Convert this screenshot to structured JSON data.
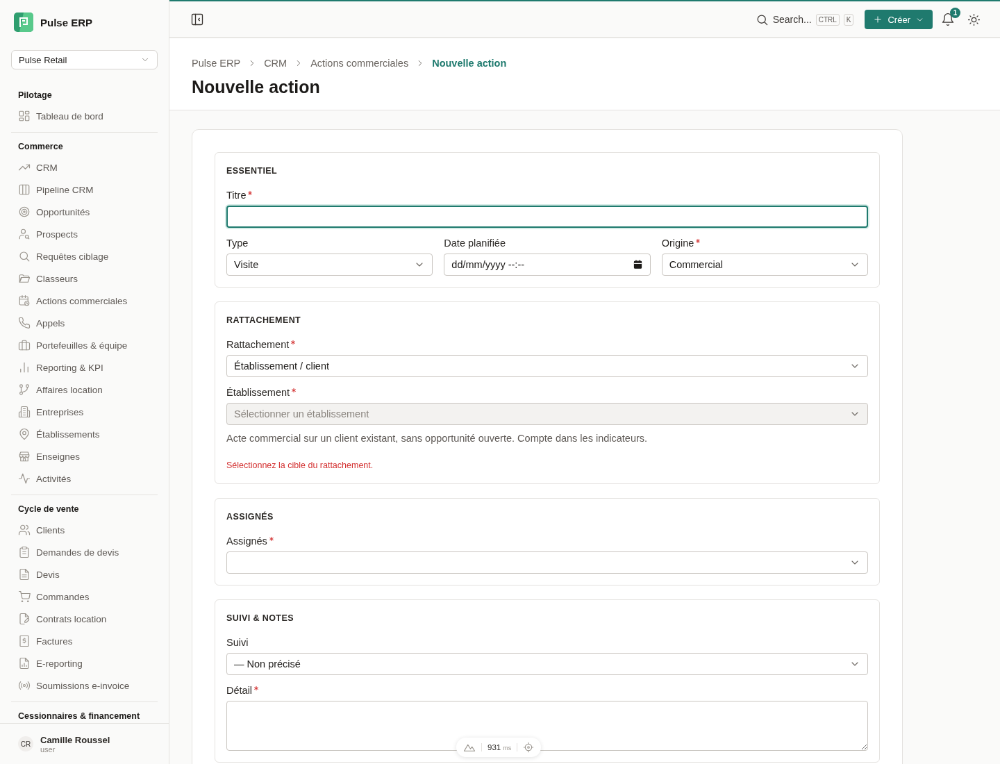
{
  "app": {
    "name": "Pulse ERP"
  },
  "workspace": {
    "value": "Pulse Retail"
  },
  "sidebar": {
    "groups": [
      {
        "title": "Pilotage",
        "items": [
          {
            "label": "Tableau de bord"
          }
        ]
      },
      {
        "title": "Commerce",
        "items": [
          {
            "label": "CRM"
          },
          {
            "label": "Pipeline CRM"
          },
          {
            "label": "Opportunités"
          },
          {
            "label": "Prospects"
          },
          {
            "label": "Requêtes ciblage"
          },
          {
            "label": "Classeurs"
          },
          {
            "label": "Actions commerciales"
          },
          {
            "label": "Appels"
          },
          {
            "label": "Portefeuilles & équipe"
          },
          {
            "label": "Reporting & KPI"
          },
          {
            "label": "Affaires location"
          },
          {
            "label": "Entreprises"
          },
          {
            "label": "Établissements"
          },
          {
            "label": "Enseignes"
          },
          {
            "label": "Activités"
          }
        ]
      },
      {
        "title": "Cycle de vente",
        "items": [
          {
            "label": "Clients"
          },
          {
            "label": "Demandes de devis"
          },
          {
            "label": "Devis"
          },
          {
            "label": "Commandes"
          },
          {
            "label": "Contrats location"
          },
          {
            "label": "Factures"
          },
          {
            "label": "E-reporting"
          },
          {
            "label": "Soumissions e-invoice"
          }
        ]
      },
      {
        "title": "Cessionnaires & financement"
      }
    ]
  },
  "user": {
    "initials": "CR",
    "name": "Camille Roussel",
    "role": "user"
  },
  "topbar": {
    "search": "Search...",
    "shortcut": [
      "CTRL",
      "K"
    ],
    "create_button": "Créer",
    "notifications": "1"
  },
  "breadcrumb": [
    {
      "label": "Pulse ERP",
      "selected": false
    },
    {
      "label": "CRM",
      "selected": false
    },
    {
      "label": "Actions commerciales",
      "selected": false
    },
    {
      "label": "Nouvelle action",
      "selected": true
    }
  ],
  "page_title": "Nouvelle action",
  "sections": [
    {
      "title": "ESSENTIEL",
      "rows": [
        [
          {
            "kind": "text",
            "label": "Titre",
            "required": true,
            "focused": true
          }
        ],
        [
          {
            "kind": "select",
            "label": "Type",
            "required": false,
            "value": "Visite"
          },
          {
            "kind": "datetime",
            "label": "Date planifiée",
            "required": false,
            "placeholder": "dd/mm/yyyy --:--"
          },
          {
            "kind": "select",
            "label": "Origine",
            "required": true,
            "value": "Commercial"
          }
        ]
      ]
    },
    {
      "title": "RATTACHEMENT",
      "rows": [
        [
          {
            "kind": "select",
            "label": "Rattachement",
            "required": true,
            "value": "Établissement / client"
          }
        ],
        [
          {
            "kind": "select",
            "label": "Établissement",
            "required": true,
            "placeholder": "Sélectionner un établissement",
            "disabled": true
          }
        ],
        [
          {
            "kind": "help",
            "text": "Acte commercial sur un client existant, sans opportunité ouverte. Compte dans les indicateurs."
          }
        ],
        [
          {
            "kind": "error",
            "text": "Sélectionnez la cible du rattachement."
          }
        ]
      ]
    },
    {
      "title": "ASSIGNÉS",
      "rows": [
        [
          {
            "kind": "select",
            "label": "Assignés",
            "required": true
          }
        ]
      ]
    },
    {
      "title": "SUIVI & NOTES",
      "rows": [
        [
          {
            "kind": "select",
            "label": "Suivi",
            "required": false,
            "value": "— Non précisé"
          }
        ],
        [
          {
            "kind": "textarea",
            "label": "Détail",
            "required": true
          }
        ]
      ]
    }
  ],
  "dev_toolbar": {
    "time": "931",
    "unit": "ms"
  }
}
